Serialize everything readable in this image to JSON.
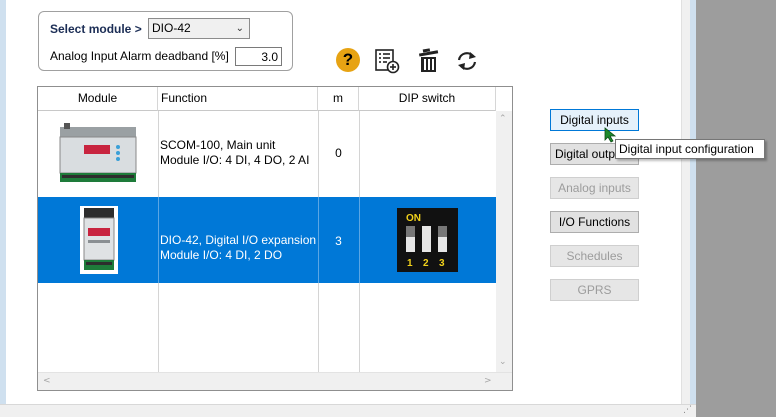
{
  "module_box": {
    "select_label": "Select module >",
    "select_value": "DIO-42",
    "deadband_label": "Analog Input Alarm deadband [%]",
    "deadband_value": "3.0"
  },
  "toolbar": {
    "help": "?",
    "icons": [
      "help-icon",
      "report-icon",
      "delete-icon",
      "refresh-icon"
    ]
  },
  "table": {
    "headers": [
      "Module",
      "Function",
      "m",
      "DIP switch"
    ],
    "rows": [
      {
        "function_line1": "SCOM-100, Main unit",
        "function_line2": "Module I/O: 4 DI, 4 DO, 2 AI",
        "m": "0",
        "selected": false
      },
      {
        "function_line1": "DIO-42, Digital I/O expansion",
        "function_line2": "Module I/O: 4 DI, 2 DO",
        "m": "3",
        "selected": true
      }
    ],
    "dip": {
      "on_label": "ON",
      "switch_labels": [
        "1",
        "2",
        "3"
      ]
    }
  },
  "buttons": {
    "digital_inputs": "Digital inputs",
    "digital_outputs": "Digital outputs",
    "analog_inputs": "Analog inputs",
    "io_functions": "I/O Functions",
    "schedules": "Schedules",
    "gprs": "GPRS"
  },
  "tooltip": "Digital input configuration",
  "colors": {
    "selection": "#0078d7",
    "help_icon": "#e7a313",
    "cursor": "#1f8a2c"
  }
}
